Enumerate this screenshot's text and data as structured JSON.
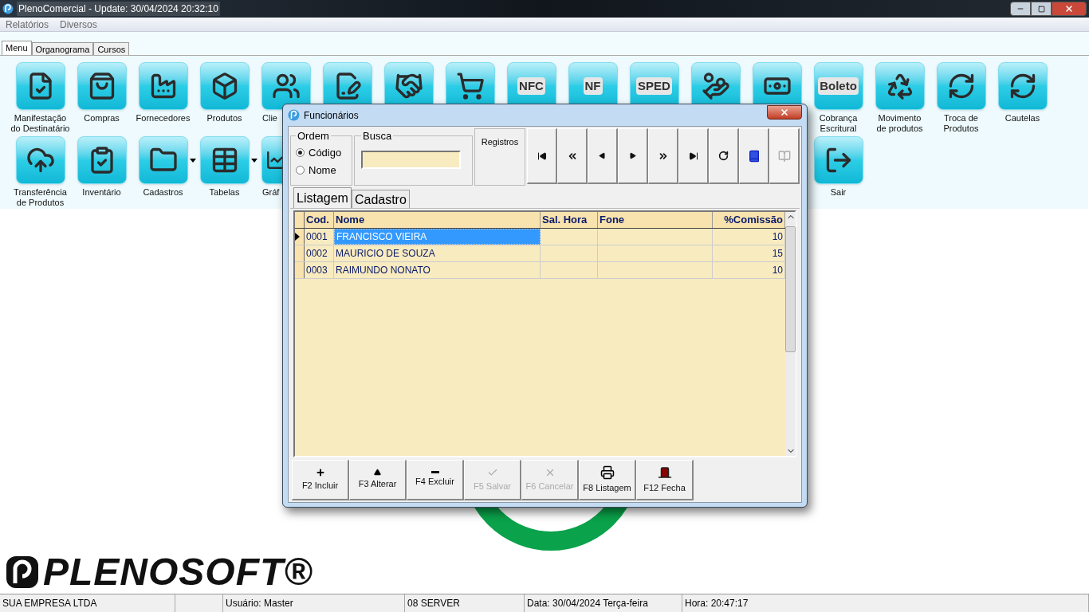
{
  "window": {
    "title": "PlenoComercial - Update: 30/04/2024 20:32:10"
  },
  "menu": [
    "Relatórios",
    "Diversos"
  ],
  "tabs": [
    {
      "label": "Menu",
      "selected": true
    },
    {
      "label": "Organograma",
      "selected": false
    },
    {
      "label": "Cursos",
      "selected": false
    }
  ],
  "tile_rows": [
    [
      {
        "kind": "tile",
        "label": "Manifestação\ndo Destinatário"
      },
      {
        "kind": "tile",
        "label": "Compras"
      },
      {
        "kind": "tile",
        "label": "Fornecedores"
      },
      {
        "kind": "tile",
        "label": "Produtos"
      },
      {
        "kind": "tile",
        "label": "Clie"
      },
      {
        "kind": "tile"
      },
      {
        "kind": "tile"
      },
      {
        "kind": "tile"
      },
      {
        "kind": "tile",
        "icon_text": "NFC"
      },
      {
        "kind": "tile",
        "icon_text": "NF"
      },
      {
        "kind": "tile",
        "icon_text": "SPED"
      },
      {
        "kind": "tile"
      },
      {
        "kind": "tile"
      },
      {
        "kind": "tile",
        "icon_text": "Boleto",
        "label": "Cobrança\nEscritural"
      },
      {
        "kind": "tile",
        "label": "Movimento\nde produtos"
      },
      {
        "kind": "tile",
        "label": "Troca de\nProdutos"
      },
      {
        "kind": "tile",
        "label": "Cautelas"
      }
    ],
    [
      {
        "kind": "tile",
        "label": "Transferência\nde Produtos"
      },
      {
        "kind": "tile",
        "label": "Inventário"
      },
      {
        "kind": "tile",
        "label": "Cadastros",
        "dropdown": true
      },
      {
        "kind": "tile",
        "label": "Tabelas",
        "dropdown": true
      },
      {
        "kind": "tile",
        "label": "Gráf"
      },
      {
        "kind": "hidden"
      },
      {
        "kind": "hidden"
      },
      {
        "kind": "hidden"
      },
      {
        "kind": "hidden"
      },
      {
        "kind": "hidden"
      },
      {
        "kind": "hidden"
      },
      {
        "kind": "hidden"
      },
      {
        "kind": "hidden"
      },
      {
        "kind": "tile",
        "label": "Sair"
      }
    ]
  ],
  "logo": {
    "text": "PLENOSOFT®"
  },
  "dialog": {
    "title": "Funcionários",
    "order": {
      "legend": "Ordem",
      "options": [
        {
          "label": "Código",
          "selected": true
        },
        {
          "label": "Nome",
          "selected": false
        }
      ]
    },
    "search": {
      "legend": "Busca"
    },
    "records_label": "Registros",
    "nav_buttons": [
      {
        "disabled": false
      },
      {
        "disabled": false
      },
      {
        "disabled": false
      },
      {
        "disabled": false
      },
      {
        "disabled": false
      },
      {
        "disabled": false
      },
      {
        "disabled": false
      },
      {
        "disabled": false
      },
      {
        "disabled": true
      }
    ],
    "tabs": [
      {
        "label": "Listagem",
        "selected": true
      },
      {
        "label": "Cadastro",
        "selected": false
      }
    ],
    "table": {
      "columns": [
        "Cod.",
        "Nome",
        "Sal. Hora",
        "Fone",
        "%Comissão"
      ],
      "rows": [
        {
          "selected": true,
          "cells": [
            "0001",
            "FRANCISCO VIEIRA",
            "",
            "",
            "10"
          ]
        },
        {
          "selected": false,
          "cells": [
            "0002",
            "MAURICIO DE SOUZA",
            "",
            "",
            "15"
          ]
        },
        {
          "selected": false,
          "cells": [
            "0003",
            "RAIMUNDO NONATO",
            "",
            "",
            "10"
          ]
        }
      ]
    },
    "buttons": [
      {
        "label": "F2 Incluir",
        "disabled": false
      },
      {
        "label": "F3 Alterar",
        "disabled": false
      },
      {
        "label": "F4 Excluir",
        "disabled": false
      },
      {
        "label": "F5 Salvar",
        "disabled": true
      },
      {
        "label": "F6 Cancelar",
        "disabled": true
      },
      {
        "label": "F8 Listagem",
        "disabled": false
      },
      {
        "label": "F12 Fecha",
        "disabled": false
      }
    ]
  },
  "status_bar": [
    "SUA EMPRESA LTDA",
    "Usuário: Master",
    "08 SERVER",
    "Data: 30/04/2024 Terça-feira",
    "Hora: 20:47:17"
  ]
}
